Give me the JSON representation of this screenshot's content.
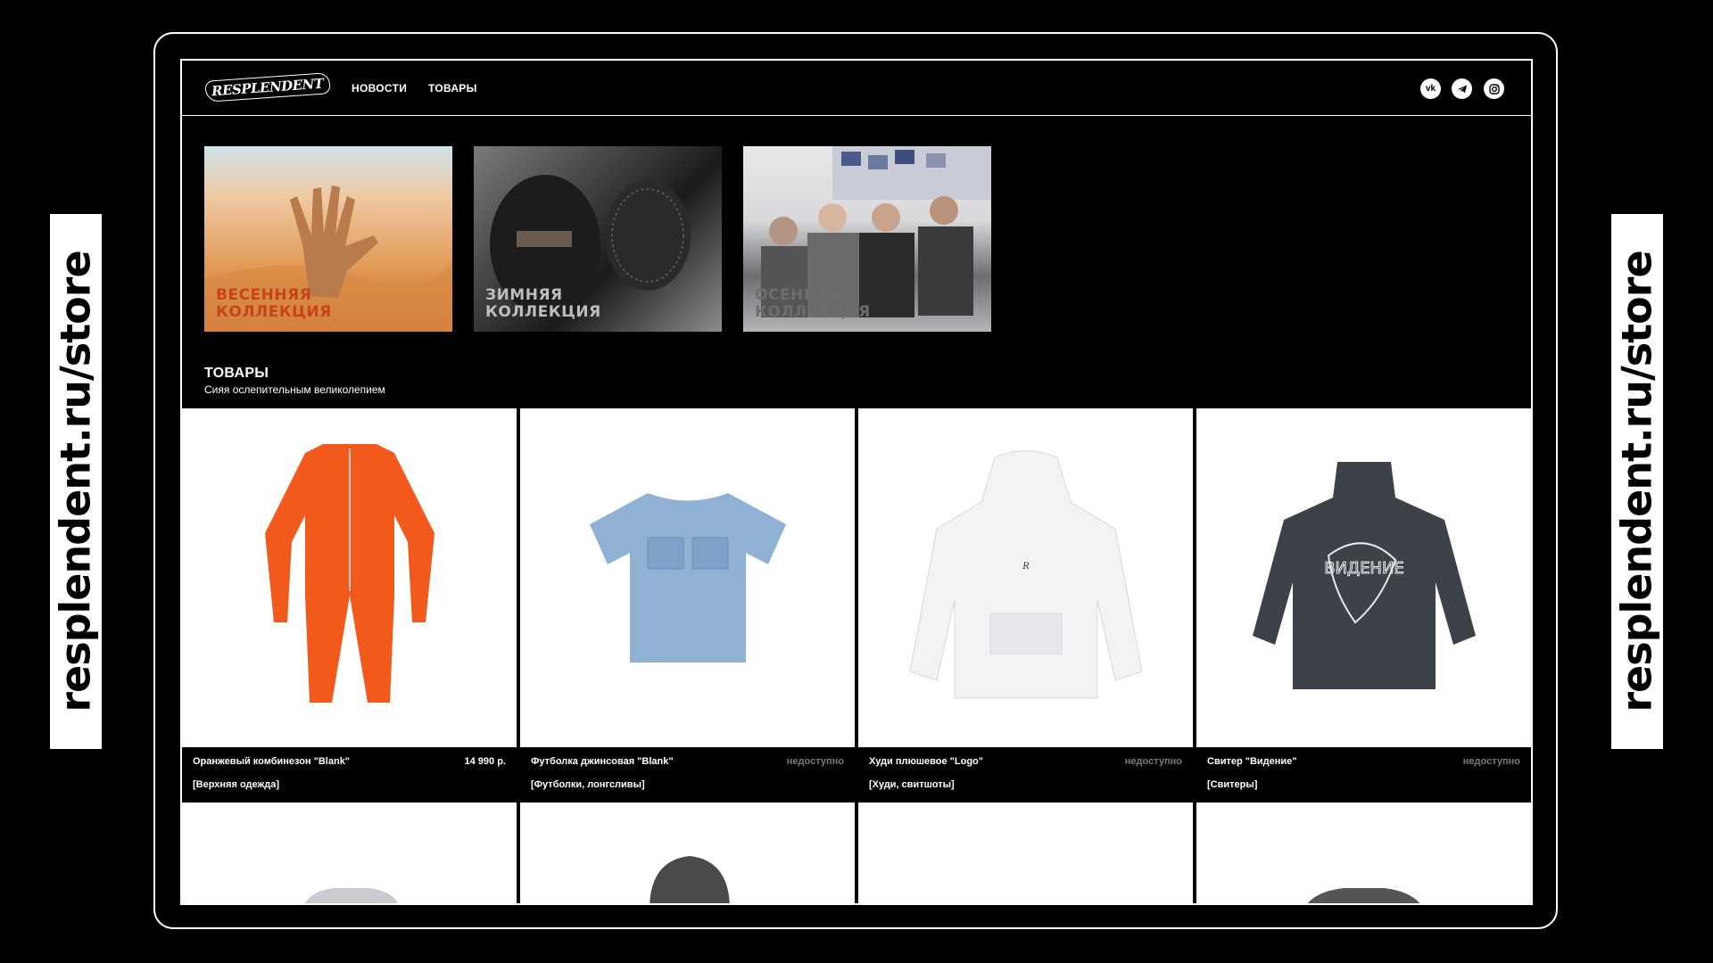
{
  "side_text": "resplendent.ru/store",
  "header": {
    "logo": "RESPLENDENT",
    "nav": [
      "НОВОСТИ",
      "ТОВАРЫ"
    ],
    "social": [
      "vk-icon",
      "telegram-icon",
      "instagram-icon"
    ]
  },
  "collections": [
    {
      "line1": "ВЕСЕННЯЯ",
      "line2": "КОЛЛЕКЦИЯ"
    },
    {
      "line1": "ЗИМНЯЯ",
      "line2": "КОЛЛЕКЦИЯ"
    },
    {
      "line1": "ОСЕННЯЯ",
      "line2": "КОЛЛЕКЦИЯ"
    }
  ],
  "section": {
    "title": "ТОВАРЫ",
    "subtitle": "Сияя ослепительным великолепием"
  },
  "products": [
    {
      "name": "Оранжевый комбинезон \"Blank\"",
      "price": "14 990 р.",
      "category": "[Верхняя одежда]"
    },
    {
      "name": "Футболка джинсовая \"Blank\"",
      "price": "недоступно",
      "category": "[Футболки, лонгсливы]"
    },
    {
      "name": "Худи плюшевое \"Logo\"",
      "price": "недоступно",
      "category": "[Худи, свитшоты]"
    },
    {
      "name": "Свитер \"Видение\"",
      "price": "недоступно",
      "category": "[Свитеры]"
    }
  ],
  "colors": {
    "background": "#000000",
    "accent_spring": "#c8431c",
    "jumpsuit": "#f15a1a",
    "denim": "#8fb2d4",
    "hoodie": "#f2f3f5",
    "sweater": "#3d4249"
  }
}
